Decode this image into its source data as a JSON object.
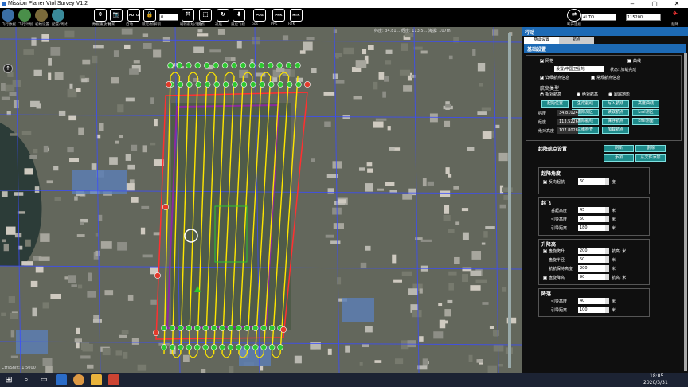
{
  "window": {
    "title": "Mission Planer Vtol Survey V1.2",
    "minimize": "–",
    "maximize": "▢",
    "close": "✕"
  },
  "toolbar": {
    "left_labels": [
      "飞行数据",
      "飞行计划",
      "初始设置",
      "配置/调试"
    ],
    "alt_field": "0",
    "tools": [
      {
        "glyph": "0",
        "label": "数据重放/比"
      },
      {
        "glyph": "📷",
        "label": "拍照"
      },
      {
        "glyph": "AUTO",
        "label": "自动"
      },
      {
        "glyph": "🔒",
        "label": "锁定/加解锁"
      },
      {
        "glyph": "⤧",
        "label": "刷新航线/定位"
      },
      {
        "glyph": "⬚",
        "label": "绕点"
      },
      {
        "glyph": "↻",
        "label": "返航"
      },
      {
        "glyph": "⬇",
        "label": "重启飞控"
      },
      {
        "glyph": "POS",
        "label": "pos"
      },
      {
        "glyph": "PPK",
        "label": "PPK"
      },
      {
        "glyph": "RTK",
        "label": "RTK"
      }
    ],
    "right_field1": "AUTO",
    "right_field2": "115200",
    "connect_label": "断开连接",
    "vtol_label": "起降"
  },
  "map": {
    "coords_text": "纬度: 34.81... 经度: 113.5... 海拔: 107m",
    "corner_label": "Ctrl/Shift: 1:5000",
    "scale_label": "0"
  },
  "panel": {
    "header": "行动",
    "tabs": [
      "基础设置",
      "航点"
    ],
    "section_title": "基础设置",
    "grid_label": "网格",
    "curve_label": "曲线",
    "frame_select": "设置/中国卫星地",
    "status_label": "状态: 加载完成",
    "detail_label": "详细航点信息",
    "common_label": "常规航点信息",
    "alt_type_title": "航高类型",
    "alt_types": [
      "相对航高",
      "绝对航高",
      "跟踪地形"
    ],
    "action_buttons": [
      [
        "起始位置",
        "生成航线",
        "写入航线",
        "高度曲线"
      ],
      [
        "",
        "删除测区",
        "读取航点",
        "kml测区"
      ],
      [
        "",
        "删除航线",
        "保存航点",
        "kml测面"
      ],
      [
        "",
        "三维检查",
        "加载航点",
        ""
      ]
    ],
    "info_rows": [
      {
        "label": "纬度",
        "value": "34.81024"
      },
      {
        "label": "经度",
        "value": "113.5226"
      },
      {
        "label": "绝对高度",
        "value": "107.8028"
      }
    ],
    "takeoff_title": "起降航点设置",
    "refresh": "刷新",
    "delete": "删除",
    "add": "添加",
    "add_file": "从文件添加",
    "angle_title": "起降角度",
    "reverse_label": "反向起航",
    "reverse_val": "60",
    "deg": "度",
    "takeoff_sec": "起飞",
    "to_rows": [
      {
        "label": "垂起高度",
        "value": "45",
        "unit": "米"
      },
      {
        "label": "引导高度",
        "value": "50",
        "unit": "米"
      },
      {
        "label": "引导距离",
        "value": "180",
        "unit": "米"
      }
    ],
    "climb_sec": "升降高",
    "climb_rows": [
      {
        "label": "盘旋爬升",
        "value": "200",
        "unit": "航高: 米",
        "check": true
      },
      {
        "label": "盘旋半径",
        "value": "50",
        "unit": "米",
        "check": false
      },
      {
        "label": "航航保持高度",
        "value": "200",
        "unit": "米",
        "check": false
      },
      {
        "label": "盘旋降高",
        "value": "90",
        "unit": "航高: 米",
        "check": true
      }
    ],
    "land_sec": "降落",
    "land_rows": [
      {
        "label": "引导高度",
        "value": "40",
        "unit": "米"
      },
      {
        "label": "引导距离",
        "value": "100",
        "unit": "米"
      }
    ]
  },
  "taskbar": {
    "time": "18:05",
    "date": "2020/3/31"
  }
}
